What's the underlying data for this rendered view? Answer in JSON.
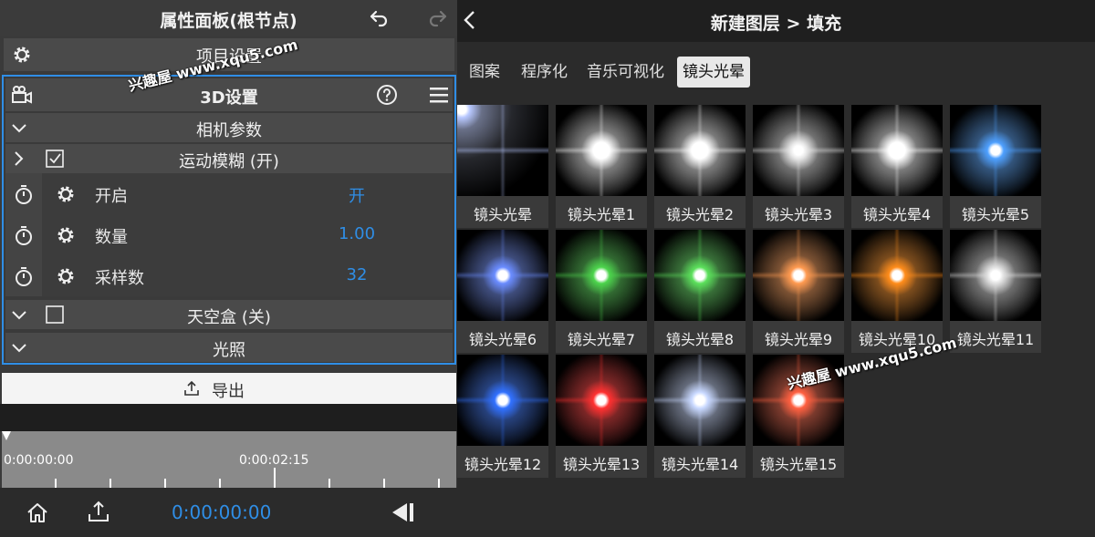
{
  "left": {
    "header_title": "属性面板(根节点)",
    "project_settings": "项目设置",
    "panel_3d": {
      "title": "3D设置",
      "camera": "相机参数",
      "motion_blur": "运动模糊 (开)",
      "params": [
        {
          "name": "开启",
          "value": "开"
        },
        {
          "name": "数量",
          "value": "1.00"
        },
        {
          "name": "采样数",
          "value": "32"
        }
      ],
      "skybox": "天空盒 (关)",
      "lighting": "光照"
    },
    "export_label": "导出",
    "timeline": {
      "start": "0:00:00:00",
      "mid": "0:00:02:15"
    },
    "current_time": "0:00:00:00"
  },
  "right": {
    "header_title": "新建图层 > 填充",
    "tabs": [
      "图案",
      "程序化",
      "音乐可视化",
      "镜头光晕"
    ],
    "active_tab": 3,
    "items": [
      {
        "label": "镜头光晕",
        "color": "#b8c8ff"
      },
      {
        "label": "镜头光晕1",
        "color": "#ffffff"
      },
      {
        "label": "镜头光晕2",
        "color": "#ffffff"
      },
      {
        "label": "镜头光晕3",
        "color": "#e8e8e8"
      },
      {
        "label": "镜头光晕4",
        "color": "#ffffff"
      },
      {
        "label": "镜头光晕5",
        "color": "#4ea0ff"
      },
      {
        "label": "镜头光晕6",
        "color": "#6a8cff"
      },
      {
        "label": "镜头光晕7",
        "color": "#4cd44c"
      },
      {
        "label": "镜头光晕8",
        "color": "#5be05b"
      },
      {
        "label": "镜头光晕9",
        "color": "#ff9a50"
      },
      {
        "label": "镜头光晕10",
        "color": "#ff8c1a"
      },
      {
        "label": "镜头光晕11",
        "color": "#e0e0e0"
      },
      {
        "label": "镜头光晕12",
        "color": "#3070ff"
      },
      {
        "label": "镜头光晕13",
        "color": "#ff3030"
      },
      {
        "label": "镜头光晕14",
        "color": "#c8d8ff"
      },
      {
        "label": "镜头光晕15",
        "color": "#ff6040"
      }
    ]
  },
  "watermark": "兴趣屋 www.xqu5.com",
  "colors": {
    "accent": "#2f8ee6"
  }
}
